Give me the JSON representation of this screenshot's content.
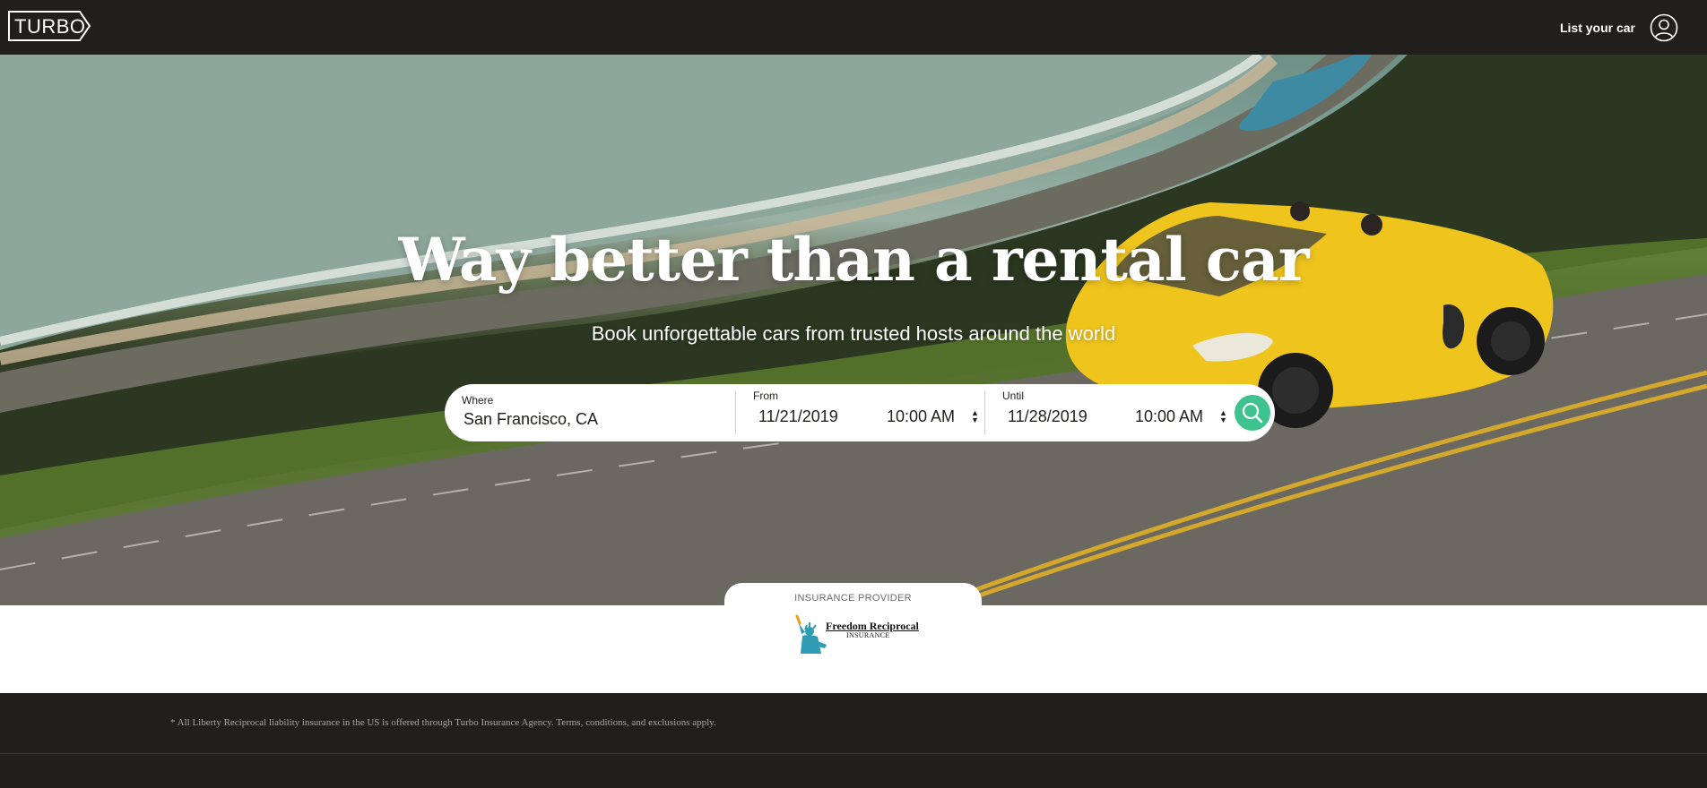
{
  "header": {
    "logo": "TURBO",
    "list_car_label": "List your car",
    "account_icon": "user-circle-icon"
  },
  "hero": {
    "title": "Way better than a rental car",
    "subtitle": "Book unforgettable cars from trusted hosts around the world"
  },
  "search": {
    "where_label": "Where",
    "where_value": "San Francisco, CA",
    "from_label": "From",
    "from_date": "11/21/2019",
    "from_time": "10:00 AM",
    "until_label": "Until",
    "until_date": "11/28/2019",
    "until_time": "10:00 AM",
    "search_icon": "search-icon",
    "accent_color": "#3ec28f"
  },
  "insurance": {
    "label": "INSURANCE PROVIDER",
    "provider_name": "Freedom Reciprocal",
    "provider_sub": "INSURANCE"
  },
  "footer": {
    "note": "* All Liberty Reciprocal liability insurance in the US is offered through Turbo Insurance Agency. Terms, conditions, and exclusions apply."
  }
}
